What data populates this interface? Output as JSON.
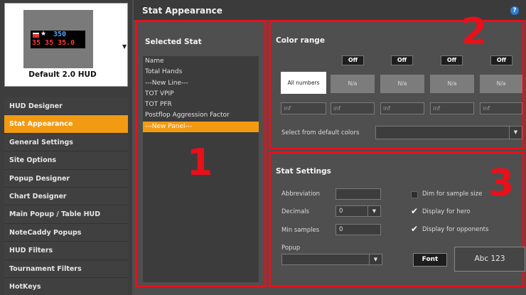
{
  "hud": {
    "name": "Default 2.0 HUD",
    "preview_top": "350",
    "preview_bottom": "35 35 35.0",
    "preview_star": "★"
  },
  "sidebar": {
    "items": [
      {
        "label": "HUD Designer"
      },
      {
        "label": "Stat Appearance"
      },
      {
        "label": "General Settings"
      },
      {
        "label": "Site Options"
      },
      {
        "label": "Popup Designer"
      },
      {
        "label": "Chart Designer"
      },
      {
        "label": "Main Popup / Table HUD"
      },
      {
        "label": "NoteCaddy Popups"
      },
      {
        "label": "HUD Filters"
      },
      {
        "label": "Tournament Filters"
      },
      {
        "label": "HotKeys"
      }
    ],
    "active_index": 1
  },
  "header": {
    "title": "Stat Appearance",
    "help_icon": "?"
  },
  "annotations": {
    "one": "1",
    "two": "2",
    "three": "3",
    "color": "#e8101a"
  },
  "selected_stat": {
    "title": "Selected Stat",
    "items": [
      "Name",
      "Total Hands",
      "---New Line---",
      "TOT VPIP",
      "TOT PFR",
      "Postflop Aggression Factor",
      "---New Panel---"
    ],
    "selected_index": 6
  },
  "color_range": {
    "title": "Color range",
    "off_buttons": [
      "Off",
      "Off",
      "Off",
      "Off"
    ],
    "cells": [
      "All numbers",
      "N/a",
      "N/a",
      "N/a",
      "N/a"
    ],
    "inputs": [
      "inf",
      "inf",
      "inf",
      "inf",
      "inf"
    ],
    "default_colors_label": "Select from default colors",
    "default_colors_value": ""
  },
  "stat_settings": {
    "title": "Stat Settings",
    "abbreviation_label": "Abbreviation",
    "abbreviation_value": "",
    "decimals_label": "Decimals",
    "decimals_value": "0",
    "min_samples_label": "Min samples",
    "min_samples_value": "0",
    "popup_label": "Popup",
    "popup_value": "",
    "dim_label": "Dim for sample size",
    "dim_checked": false,
    "hero_label": "Display for hero",
    "hero_checked": true,
    "opponents_label": "Display for opponents",
    "opponents_checked": true,
    "font_button": "Font",
    "preview_text": "Abc 123"
  },
  "colors": {
    "accent": "#f29a12",
    "annotation": "#e8101a",
    "help": "#2a7fd4"
  }
}
